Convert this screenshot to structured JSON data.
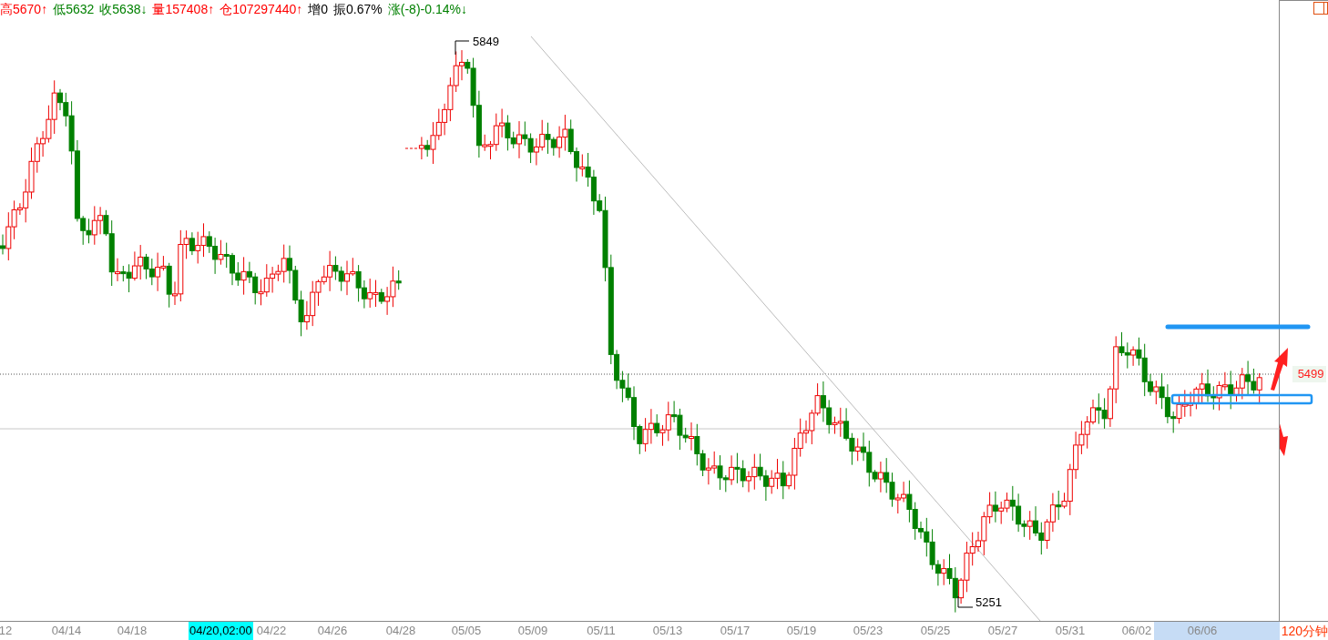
{
  "info_bar": [
    {
      "text": "高5670↑",
      "color": "#ff0000"
    },
    {
      "text": "低5632",
      "color": "#008000"
    },
    {
      "text": "收5638↓",
      "color": "#008000"
    },
    {
      "text": "量157408↑",
      "color": "#ff0000"
    },
    {
      "text": "仓107297440↑",
      "color": "#ff0000"
    },
    {
      "text": "增0",
      "color": "#000000"
    },
    {
      "text": "振0.67%",
      "color": "#000000"
    },
    {
      "text": "涨(-8)-0.14%↓",
      "color": "#008000"
    }
  ],
  "chart": {
    "high_label": "5849",
    "low_label": "5251",
    "price_tag": "5499"
  },
  "x_axis": {
    "labels": [
      {
        "text": "12",
        "selected": false
      },
      {
        "text": "04/14",
        "selected": false
      },
      {
        "text": "04/18",
        "selected": false
      },
      {
        "text": "04/22",
        "selected": false
      },
      {
        "text": "04/26",
        "selected": false
      },
      {
        "text": "04/28",
        "selected": false
      },
      {
        "text": "05/05",
        "selected": false
      },
      {
        "text": "05/09",
        "selected": false
      },
      {
        "text": "05/11",
        "selected": false
      },
      {
        "text": "05/13",
        "selected": false
      },
      {
        "text": "05/17",
        "selected": false
      },
      {
        "text": "05/19",
        "selected": false
      },
      {
        "text": "05/23",
        "selected": false
      },
      {
        "text": "05/25",
        "selected": false
      },
      {
        "text": "05/27",
        "selected": false
      },
      {
        "text": "05/31",
        "selected": false
      },
      {
        "text": "06/02",
        "selected": false
      },
      {
        "text": "06/06",
        "selected": true
      }
    ],
    "cursor_label": "04/20,02:00"
  },
  "period": "120分钟"
}
